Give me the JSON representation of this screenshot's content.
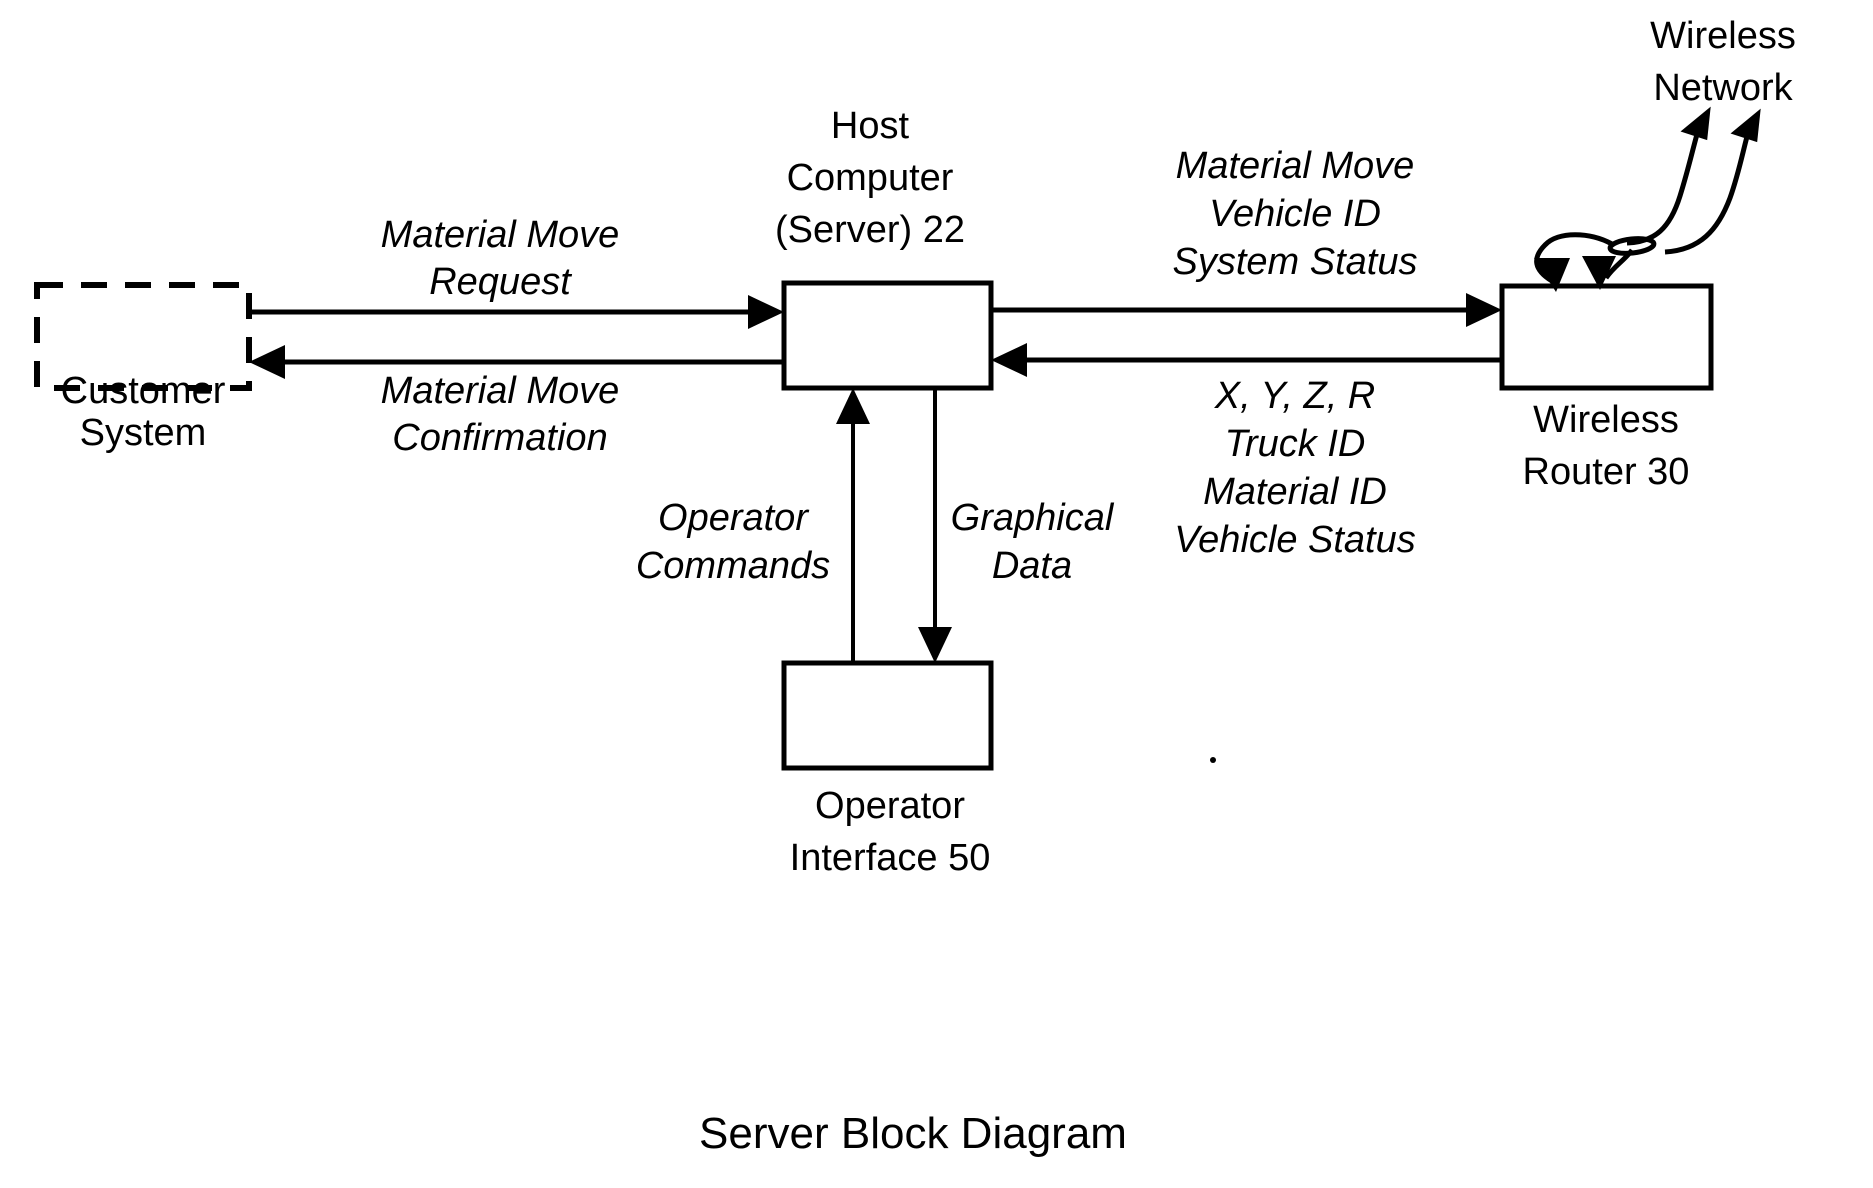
{
  "diagram": {
    "title": "Server Block Diagram",
    "nodes": {
      "customer_system": {
        "line1": "Customer",
        "line2": "System",
        "style": "dashed"
      },
      "host_computer": {
        "line1": "Host",
        "line2": "Computer",
        "line3": "(Server) 22",
        "style": "solid"
      },
      "wireless_router": {
        "line1": "Wireless",
        "line2": "Router 30",
        "style": "solid"
      },
      "operator_interface": {
        "line1": "Operator",
        "line2": "Interface 50",
        "style": "solid"
      },
      "wireless_network": {
        "line1": "Wireless",
        "line2": "Network",
        "style": "label-only"
      }
    },
    "edges": {
      "material_move_request": {
        "line1": "Material Move",
        "line2": "Request",
        "from": "customer_system",
        "to": "host_computer",
        "direction": "right"
      },
      "material_move_confirmation": {
        "line1": "Material Move",
        "line2": "Confirmation",
        "from": "host_computer",
        "to": "customer_system",
        "direction": "left"
      },
      "host_to_router": {
        "line1": "Material Move",
        "line2": "Vehicle ID",
        "line3": "System Status",
        "from": "host_computer",
        "to": "wireless_router",
        "direction": "right"
      },
      "router_to_host": {
        "line1": "X, Y, Z, R",
        "line2": "Truck ID",
        "line3": "Material ID",
        "line4": "Vehicle Status",
        "from": "wireless_router",
        "to": "host_computer",
        "direction": "left"
      },
      "operator_commands": {
        "line1": "Operator",
        "line2": "Commands",
        "from": "operator_interface",
        "to": "host_computer",
        "direction": "up"
      },
      "graphical_data": {
        "line1": "Graphical",
        "line2": "Data",
        "from": "host_computer",
        "to": "operator_interface",
        "direction": "down"
      },
      "router_wireless_link": {
        "from": "wireless_router",
        "to": "wireless_network",
        "direction": "bidirectional-curved"
      }
    },
    "colors": {
      "stroke": "#000000",
      "fill": "#ffffff",
      "text": "#000000"
    }
  }
}
